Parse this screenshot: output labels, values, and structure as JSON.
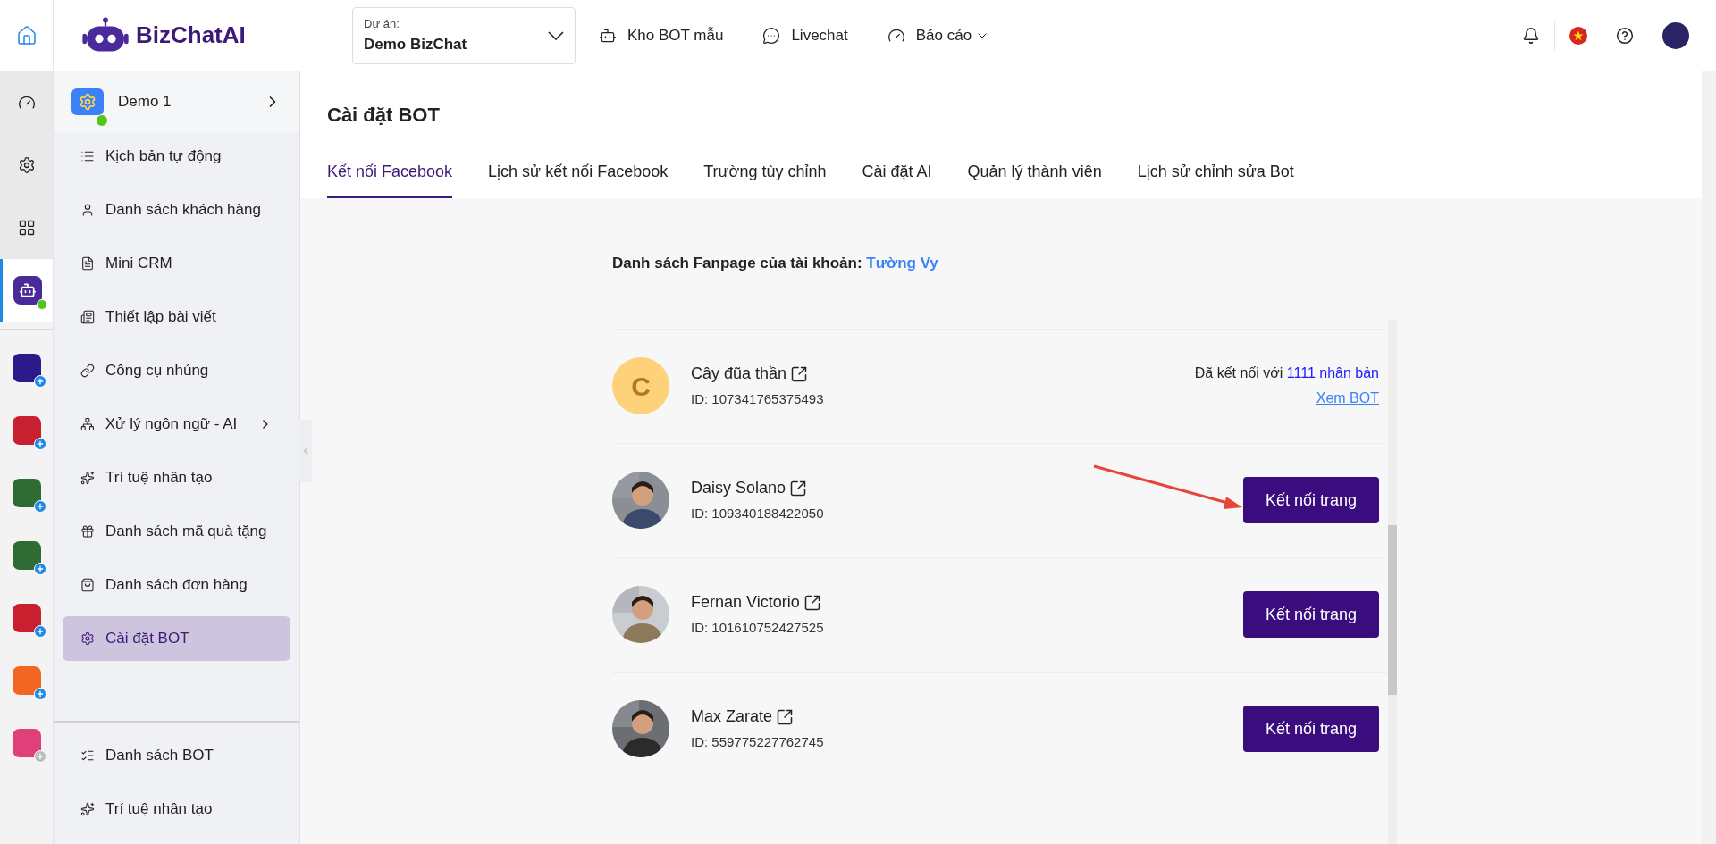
{
  "top_bar": {
    "logo": "BizChatAI",
    "project": {
      "label": "Dự án:",
      "value": "Demo BizChat"
    },
    "nav": [
      {
        "label": "Kho BOT mẫu",
        "kind": "link"
      },
      {
        "label": "Livechat",
        "kind": "link"
      },
      {
        "label": "Báo cáo",
        "kind": "dropdown"
      }
    ]
  },
  "rail": {
    "items": [
      {
        "selected": false
      },
      {
        "selected": false
      },
      {
        "selected": false
      },
      {
        "selected": true,
        "online": true
      }
    ],
    "apps": [
      {
        "color": "#2a1a8a",
        "disabled": false
      },
      {
        "color": "#c8202e",
        "disabled": false
      },
      {
        "color": "#2e6b35",
        "disabled": false
      },
      {
        "color": "#2e6b35",
        "disabled": false
      },
      {
        "color": "#c8202e",
        "disabled": false
      },
      {
        "color": "#f26522",
        "disabled": false
      },
      {
        "color": "#e0407a",
        "disabled": true
      }
    ]
  },
  "sidebar": {
    "bot": {
      "name": "Demo 1",
      "online": true
    },
    "items": [
      {
        "label": "Kịch bản tự động",
        "selected": false,
        "submenu": false
      },
      {
        "label": "Danh sách khách hàng",
        "selected": false,
        "submenu": false
      },
      {
        "label": "Mini CRM",
        "selected": false,
        "submenu": false
      },
      {
        "label": "Thiết lập bài viết",
        "selected": false,
        "submenu": false
      },
      {
        "label": "Công cụ nhúng",
        "selected": false,
        "submenu": false
      },
      {
        "label": "Xử lý ngôn ngữ - AI",
        "selected": false,
        "submenu": true
      },
      {
        "label": "Trí tuệ nhân tạo",
        "selected": false,
        "submenu": false
      },
      {
        "label": "Danh sách mã quà tặng",
        "selected": false,
        "submenu": false
      },
      {
        "label": "Danh sách đơn hàng",
        "selected": false,
        "submenu": false
      },
      {
        "label": "Cài đặt BOT",
        "selected": true,
        "submenu": false
      }
    ],
    "bottom_items": [
      {
        "label": "Danh sách BOT"
      },
      {
        "label": "Trí tuệ nhân tạo"
      }
    ]
  },
  "page": {
    "title": "Cài đặt BOT",
    "tabs": [
      {
        "label": "Kết nối Facebook",
        "selected": true
      },
      {
        "label": "Lịch sử kết nối Facebook",
        "selected": false
      },
      {
        "label": "Trường tùy chỉnh",
        "selected": false
      },
      {
        "label": "Cài đặt AI",
        "selected": false
      },
      {
        "label": "Quản lý thành viên",
        "selected": false
      },
      {
        "label": "Lịch sử chỉnh sửa Bot",
        "selected": false
      }
    ],
    "account": {
      "label": "Danh sách Fanpage của tài khoản:",
      "name": "Tường Vy"
    },
    "fanpages": [
      {
        "name": "Cây đũa thần",
        "id": "ID: 107341765375493",
        "initial": "C",
        "kind": "connected",
        "connected_text": "Đã kết nối với",
        "clones": "1111 nhân bản",
        "link": "Xem BOT"
      },
      {
        "name": "Daisy Solano",
        "id": "ID: 109340188422050",
        "kind": "unconnected",
        "button": "Kết nối trang"
      },
      {
        "name": "Fernan Victorio",
        "id": "ID: 101610752427525",
        "kind": "unconnected",
        "button": "Kết nối trang"
      },
      {
        "name": "Max Zarate",
        "id": "ID: 559775227762745",
        "kind": "unconnected",
        "button": "Kết nối trang"
      }
    ]
  }
}
